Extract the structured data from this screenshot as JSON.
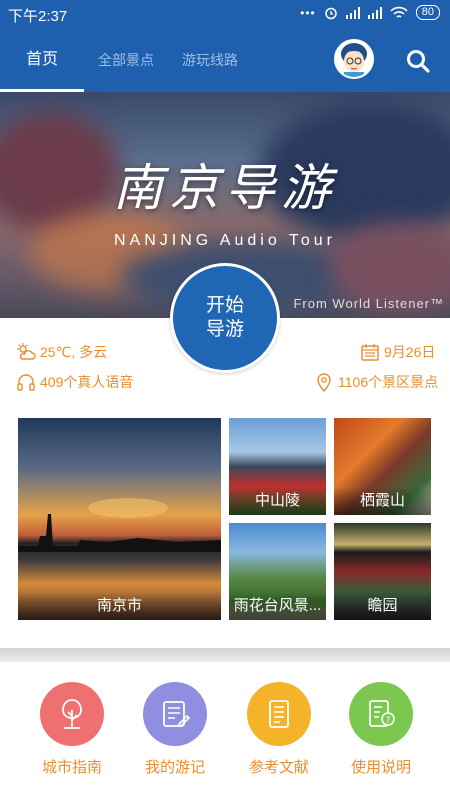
{
  "status_bar": {
    "time": "下午2:37",
    "battery": "80",
    "network": "HD"
  },
  "nav": {
    "tabs": [
      {
        "label": "首页",
        "active": true
      },
      {
        "label": "全部景点",
        "active": false
      },
      {
        "label": "游玩线路",
        "active": false
      }
    ],
    "icons": [
      "avatar",
      "search-icon"
    ]
  },
  "banner": {
    "title": "南京导游",
    "subtitle": "NANJING Audio Tour",
    "credit": "From World Listener™"
  },
  "start_button": {
    "line1": "开始",
    "line2": "导游"
  },
  "info": {
    "weather": "25℃, 多云",
    "date": "9月26日",
    "voices": "409个真人语音",
    "spots": "1106个景区景点",
    "icons": [
      "weather-icon",
      "calendar-icon",
      "headphones-icon",
      "location-pin-icon"
    ]
  },
  "attractions": [
    {
      "label": "南京市"
    },
    {
      "label": "中山陵"
    },
    {
      "label": "栖霞山"
    },
    {
      "label": "雨花台风景..."
    },
    {
      "label": "瞻园"
    }
  ],
  "features": [
    {
      "label": "城市指南",
      "color": "#ef7070",
      "icon": "tree-icon"
    },
    {
      "label": "我的游记",
      "color": "#8f8ee0",
      "icon": "notes-edit-icon"
    },
    {
      "label": "参考文献",
      "color": "#f5b32a",
      "icon": "document-icon"
    },
    {
      "label": "使用说明",
      "color": "#7cc750",
      "icon": "help-document-icon"
    }
  ],
  "colors": {
    "primary": "#1e5fae",
    "accent": "#e98f2f"
  }
}
